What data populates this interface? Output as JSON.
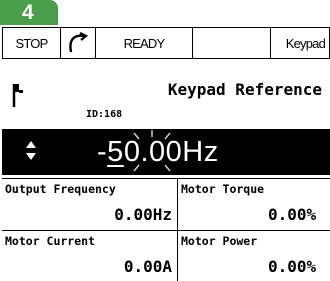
{
  "page_badge": "4",
  "status": {
    "stop": "STOP",
    "rotation_icon": "rotation-arrow-icon",
    "ready": "READY",
    "empty": "",
    "keypad": "Keypad"
  },
  "header": {
    "title": "Keypad Reference",
    "id": "ID:168",
    "icon": "parameter-flag-icon"
  },
  "value": {
    "sign": "-",
    "digit_cursor": "5",
    "rest": "0.00",
    "unit": "Hz",
    "adjust_icon": "up-down-arrows-icon"
  },
  "monitor": [
    {
      "label": "Output Frequency",
      "value": "0.00Hz"
    },
    {
      "label": "Motor Torque",
      "value": "0.00%"
    },
    {
      "label": "Motor Current",
      "value": "0.00A"
    },
    {
      "label": "Motor Power",
      "value": "0.00%"
    }
  ],
  "colors": {
    "badge": "#4a9d4a",
    "value_bar": "#000000"
  }
}
